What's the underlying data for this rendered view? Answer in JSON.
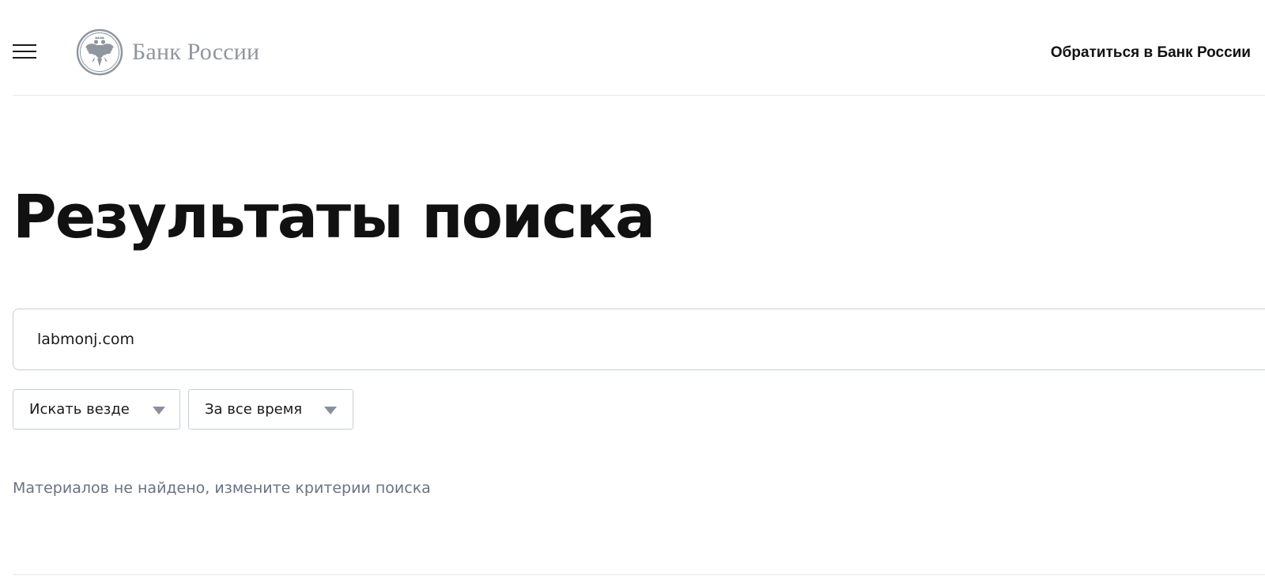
{
  "header": {
    "logo_text": "Банк России",
    "contact_link": "Обратиться в Банк России"
  },
  "main": {
    "title": "Результаты поиска",
    "search": {
      "value": "labmonj.com"
    },
    "filters": [
      {
        "label": "Искать везде"
      },
      {
        "label": "За все время"
      }
    ],
    "empty_message": "Материалов не найдено, измените критерии поиска"
  },
  "icons": {
    "menu": "hamburger-menu-icon",
    "logo": "double-headed-eagle-emblem",
    "dropdown": "triangle-down-icon"
  },
  "colors": {
    "logo_grey": "#8f969f",
    "text_dark": "#111111",
    "muted_text": "#6b7280",
    "border": "#c9cdd3"
  }
}
